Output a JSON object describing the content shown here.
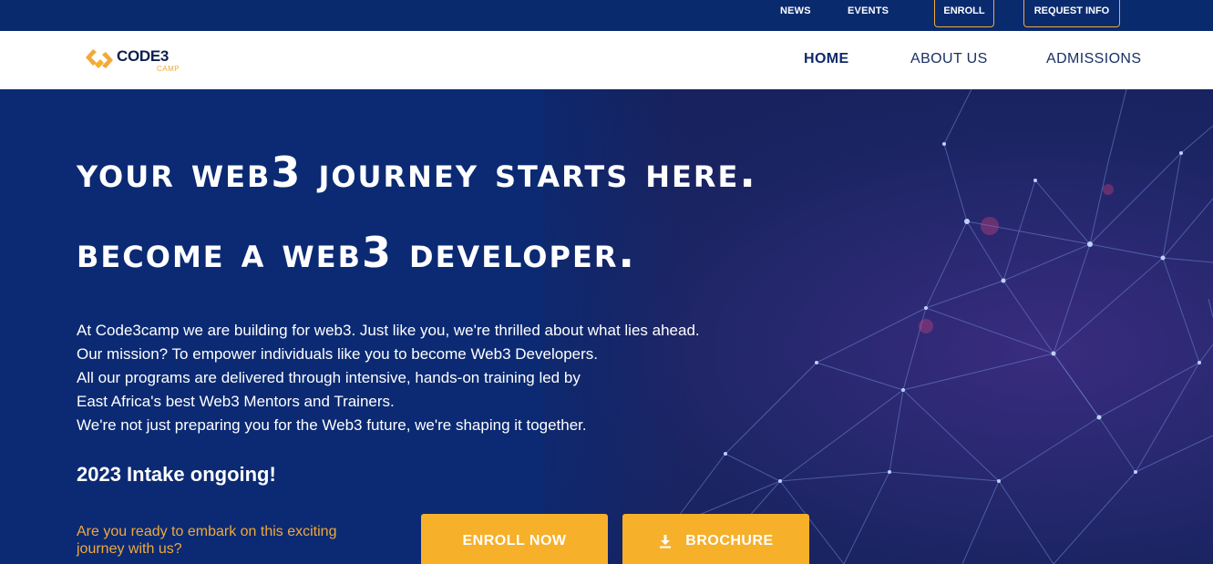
{
  "topbar": {
    "news": "NEWS",
    "events": "EVENTS",
    "enroll": "ENROLL",
    "request_info": "REQUEST INFO"
  },
  "brand": {
    "name": "CODE3",
    "sub": "CAMP",
    "logo_icon": "code3-logo-mark",
    "colors": {
      "navy": "#0a2a6e",
      "accent": "#f0a93a",
      "button": "#f6b02a"
    }
  },
  "nav": {
    "items": [
      {
        "label": "HOME",
        "active": true
      },
      {
        "label": "ABOUT US",
        "active": false
      },
      {
        "label": "ADMISSIONS",
        "active": false
      }
    ]
  },
  "hero": {
    "headline_1": "Your Web3 Journey starts here.",
    "headline_2": "Become a Web3 Developer.",
    "mission_lines": [
      "At Code3camp we are building for web3. Just like you, we're thrilled about what lies ahead.",
      "Our mission? To empower individuals like you to become Web3 Developers.",
      "All our programs are delivered through intensive, hands-on training led by",
      "East Africa's best Web3 Mentors and Trainers.",
      "We're not just preparing you for the Web3 future, we're shaping it together."
    ],
    "intake": "2023 Intake ongoing!",
    "question": "Are you ready to embark on this exciting journey with us?",
    "enroll_now": "ENROLL NOW",
    "brochure": "BROCHURE",
    "brochure_icon": "download-icon"
  }
}
